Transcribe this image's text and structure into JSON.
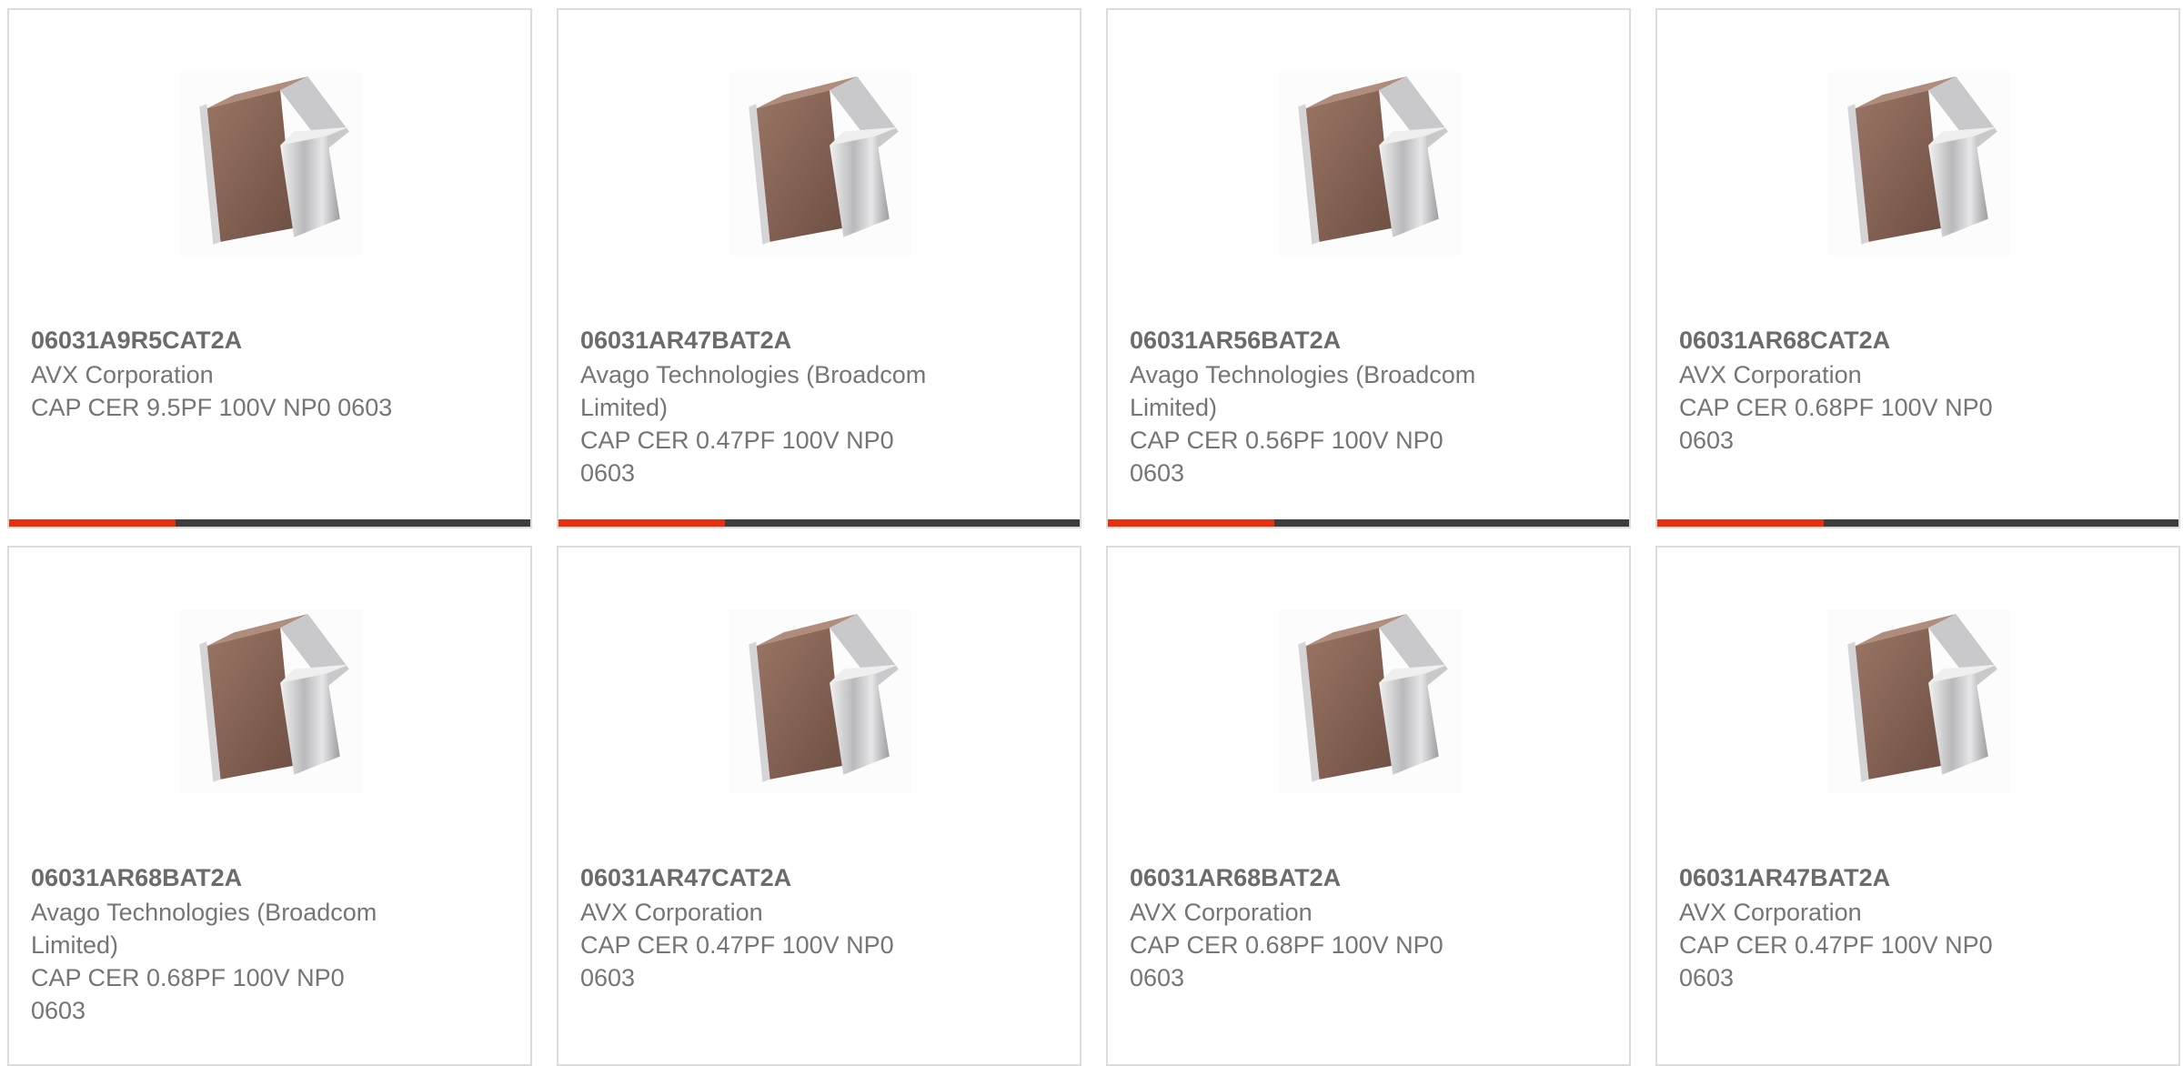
{
  "colors": {
    "accent": "#e8300f",
    "bar": "#3d3d3d",
    "border": "#dcdcdc",
    "text": "#757575"
  },
  "products": [
    {
      "part_number": "06031A9R5CAT2A",
      "manufacturer": "AVX Corporation",
      "description": "CAP CER 9.5PF 100V NP0 0603",
      "image_icon": "ceramic-capacitor-image"
    },
    {
      "part_number": "06031AR47BAT2A",
      "manufacturer": "Avago Technologies (Broadcom Limited)",
      "description": "CAP CER 0.47PF 100V NP0 0603",
      "image_icon": "ceramic-capacitor-image"
    },
    {
      "part_number": "06031AR56BAT2A",
      "manufacturer": "Avago Technologies (Broadcom Limited)",
      "description": "CAP CER 0.56PF 100V NP0 0603",
      "image_icon": "ceramic-capacitor-image"
    },
    {
      "part_number": "06031AR68CAT2A",
      "manufacturer": "AVX Corporation",
      "description": "CAP CER 0.68PF 100V NP0 0603",
      "image_icon": "ceramic-capacitor-image"
    },
    {
      "part_number": "06031AR68BAT2A",
      "manufacturer": "Avago Technologies (Broadcom Limited)",
      "description": "CAP CER 0.68PF 100V NP0 0603",
      "image_icon": "ceramic-capacitor-image"
    },
    {
      "part_number": "06031AR47CAT2A",
      "manufacturer": "AVX Corporation",
      "description": "CAP CER 0.47PF 100V NP0 0603",
      "image_icon": "ceramic-capacitor-image"
    },
    {
      "part_number": "06031AR68BAT2A",
      "manufacturer": "AVX Corporation",
      "description": "CAP CER 0.68PF 100V NP0 0603",
      "image_icon": "ceramic-capacitor-image"
    },
    {
      "part_number": "06031AR47BAT2A",
      "manufacturer": "AVX Corporation",
      "description": "CAP CER 0.47PF 100V NP0 0603",
      "image_icon": "ceramic-capacitor-image"
    }
  ]
}
